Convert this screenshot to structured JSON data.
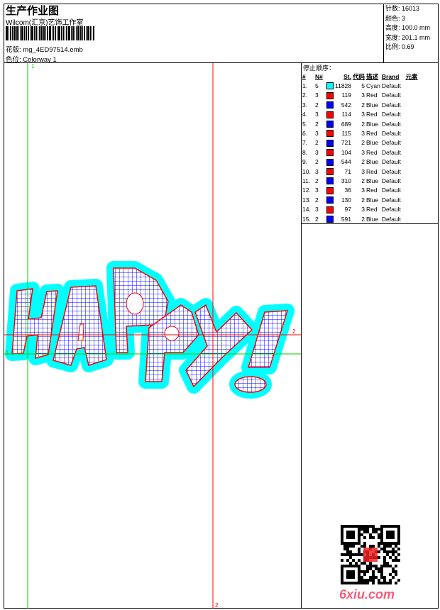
{
  "header": {
    "title": "生产作业图",
    "company": "Wilcom(汇京)艺饰工作室",
    "design_label": "花版:",
    "design_file": "mg_4ED97514.emb",
    "colorway_label": "色位:",
    "colorway": "Colorway 1"
  },
  "info": [
    {
      "label": "针数:",
      "value": "16013"
    },
    {
      "label": "颜色:",
      "value": "3"
    },
    {
      "label": "高度:",
      "value": "100.0 mm"
    },
    {
      "label": "宽度:",
      "value": "201.1 mm"
    },
    {
      "label": "比例:",
      "value": "0.69"
    }
  ],
  "stop_sequence": {
    "label": "停止顺序：",
    "columns": [
      "#",
      "N#",
      "",
      "St.",
      "代码",
      "描述",
      "Brand",
      "元素"
    ],
    "rows": [
      {
        "n": "1.",
        "needle": "5",
        "color": "#00ffff",
        "st": "11828",
        "code": "5",
        "desc": "Cyan",
        "brand": "Default"
      },
      {
        "n": "2.",
        "needle": "3",
        "color": "#ff0000",
        "st": "119",
        "code": "3",
        "desc": "Red",
        "brand": "Default"
      },
      {
        "n": "3.",
        "needle": "2",
        "color": "#0000ff",
        "st": "542",
        "code": "2",
        "desc": "Blue",
        "brand": "Default"
      },
      {
        "n": "4.",
        "needle": "3",
        "color": "#ff0000",
        "st": "114",
        "code": "3",
        "desc": "Red",
        "brand": "Default"
      },
      {
        "n": "5.",
        "needle": "2",
        "color": "#0000ff",
        "st": "689",
        "code": "2",
        "desc": "Blue",
        "brand": "Default"
      },
      {
        "n": "6.",
        "needle": "3",
        "color": "#ff0000",
        "st": "115",
        "code": "3",
        "desc": "Red",
        "brand": "Default"
      },
      {
        "n": "7.",
        "needle": "2",
        "color": "#0000ff",
        "st": "721",
        "code": "2",
        "desc": "Blue",
        "brand": "Default"
      },
      {
        "n": "8.",
        "needle": "3",
        "color": "#ff0000",
        "st": "104",
        "code": "3",
        "desc": "Red",
        "brand": "Default"
      },
      {
        "n": "9.",
        "needle": "2",
        "color": "#0000ff",
        "st": "544",
        "code": "2",
        "desc": "Blue",
        "brand": "Default"
      },
      {
        "n": "10.",
        "needle": "3",
        "color": "#ff0000",
        "st": "71",
        "code": "3",
        "desc": "Red",
        "brand": "Default"
      },
      {
        "n": "11.",
        "needle": "2",
        "color": "#0000ff",
        "st": "310",
        "code": "2",
        "desc": "Blue",
        "brand": "Default"
      },
      {
        "n": "12.",
        "needle": "3",
        "color": "#ff0000",
        "st": "36",
        "code": "3",
        "desc": "Red",
        "brand": "Default"
      },
      {
        "n": "13.",
        "needle": "2",
        "color": "#0000ff",
        "st": "130",
        "code": "2",
        "desc": "Blue",
        "brand": "Default"
      },
      {
        "n": "14.",
        "needle": "3",
        "color": "#ff0000",
        "st": "97",
        "code": "3",
        "desc": "Red",
        "brand": "Default"
      },
      {
        "n": "15.",
        "needle": "2",
        "color": "#0000ff",
        "st": "591",
        "code": "2",
        "desc": "Blue",
        "brand": "Default"
      }
    ]
  },
  "guides": {
    "marker1": "1",
    "marker2": "2",
    "color1": "#00cc00",
    "color2": "#ff0000"
  },
  "watermark": "6xiu.com"
}
